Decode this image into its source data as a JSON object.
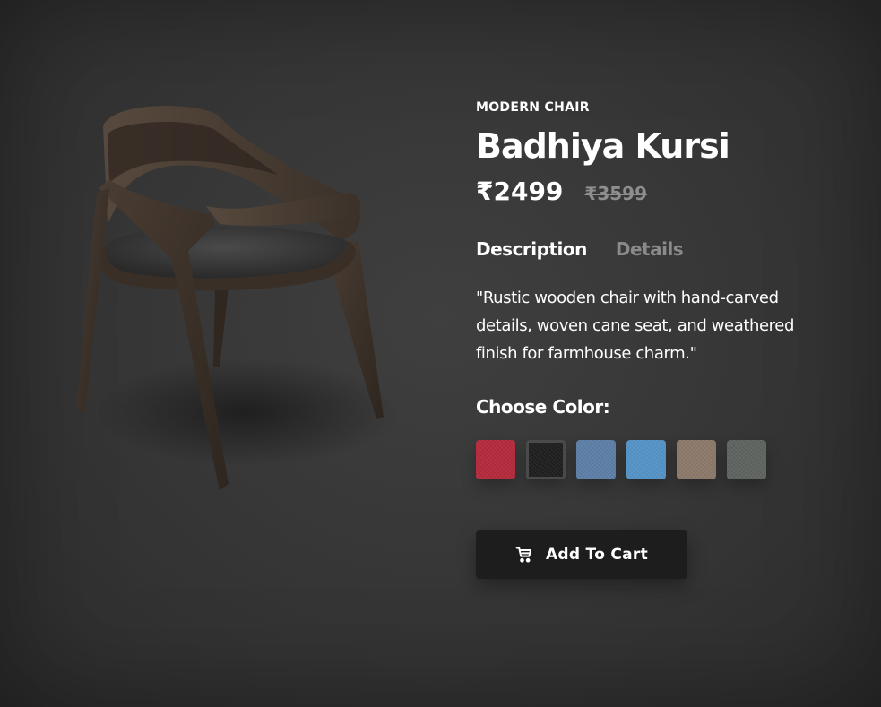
{
  "product": {
    "category": "MODERN CHAIR",
    "name": "Badhiya Kursi",
    "price": "₹2499",
    "old_price": "₹3599",
    "image_icon": "chair-image"
  },
  "tabs": [
    {
      "label": "Description",
      "active": true
    },
    {
      "label": "Details",
      "active": false
    }
  ],
  "description": "\"Rustic wooden chair with hand-carved details, woven cane seat, and weathered finish for farmhouse charm.\"",
  "color_picker": {
    "label": "Choose Color:",
    "swatches": [
      {
        "color": "#b52a3c",
        "selected": false
      },
      {
        "color": "#1f1f1f",
        "selected": true
      },
      {
        "color": "#5e7fa8",
        "selected": false
      },
      {
        "color": "#5594c8",
        "selected": false
      },
      {
        "color": "#8c7a6a",
        "selected": false
      },
      {
        "color": "#5f6460",
        "selected": false
      }
    ]
  },
  "cart_button": {
    "label": "Add To Cart",
    "icon": "cart-icon"
  }
}
